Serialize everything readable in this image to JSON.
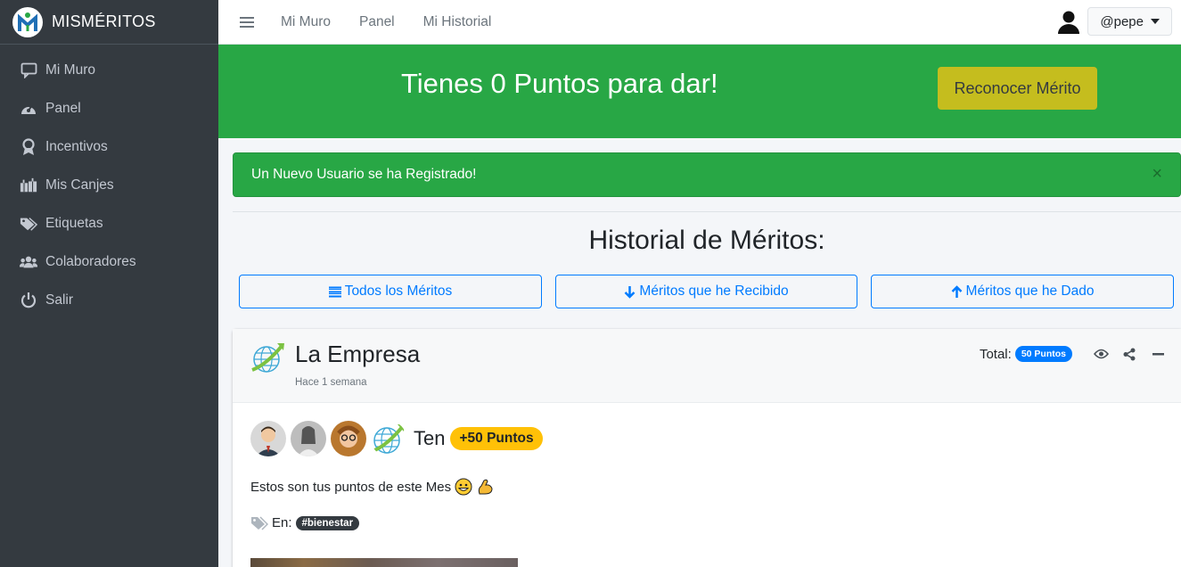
{
  "brand": {
    "prefix": "MIS",
    "suffix": "MÉRITOS"
  },
  "sidebar": {
    "items": [
      {
        "label": "Mi Muro",
        "icon": "comment-icon"
      },
      {
        "label": "Panel",
        "icon": "dashboard-gauge-icon"
      },
      {
        "label": "Incentivos",
        "icon": "award-icon"
      },
      {
        "label": "Mis Canjes",
        "icon": "gifts-icon"
      },
      {
        "label": "Etiquetas",
        "icon": "tags-icon"
      },
      {
        "label": "Colaboradores",
        "icon": "users-icon"
      },
      {
        "label": "Salir",
        "icon": "power-icon"
      }
    ]
  },
  "topbar": {
    "links": [
      "Mi Muro",
      "Panel",
      "Mi Historial"
    ],
    "user": "@pepe"
  },
  "banner": {
    "title": "Tienes 0 Puntos para dar!",
    "button": "Reconocer Mérito"
  },
  "alert": {
    "text": "Un Nuevo Usuario se ha Registrado!",
    "close": "×"
  },
  "history": {
    "title": "Historial de Méritos:",
    "filters": [
      "Todos los Méritos",
      "Méritos que he Recibido",
      "Méritos que he Dado"
    ]
  },
  "card": {
    "title": "La Empresa",
    "time": "Hace 1 semana",
    "total_label": "Total:",
    "total_badge": "50 Puntos",
    "ten": "Ten",
    "points": "+50 Puntos",
    "message": "Estos son tus puntos de este Mes",
    "tags_label": "En:",
    "tag": "#bienestar"
  },
  "colors": {
    "sidebar": "#343a40",
    "green": "#28a745",
    "yellow_button": "#c5bd1e",
    "primary": "#007bff",
    "points": "#ffc107"
  }
}
